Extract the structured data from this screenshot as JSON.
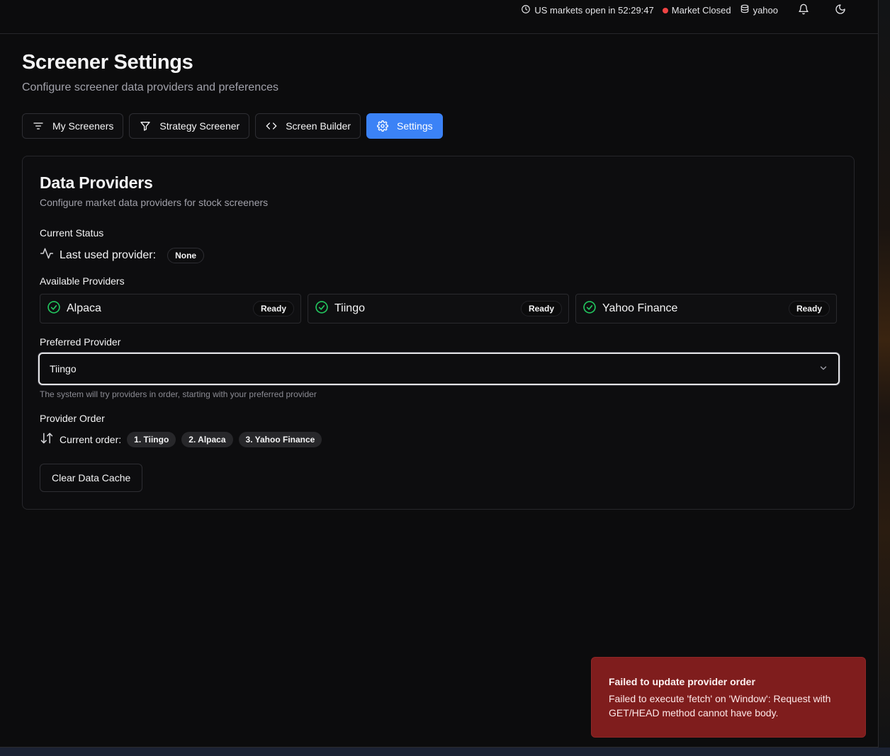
{
  "topbar": {
    "countdown": "US markets open in 52:29:47",
    "market_status": "Market Closed",
    "source": "yahoo",
    "market_status_color": "#ef4444"
  },
  "page": {
    "title": "Screener Settings",
    "subtitle": "Configure screener data providers and preferences"
  },
  "tabs": [
    {
      "label": "My Screeners",
      "icon": "filter-lines-icon",
      "active": false
    },
    {
      "label": "Strategy Screener",
      "icon": "funnel-icon",
      "active": false
    },
    {
      "label": "Screen Builder",
      "icon": "code-icon",
      "active": false
    },
    {
      "label": "Settings",
      "icon": "gear-icon",
      "active": true
    }
  ],
  "accent_color": "#3b82f6",
  "card": {
    "title": "Data Providers",
    "description": "Configure market data providers for stock screeners",
    "current_status_label": "Current Status",
    "last_used_label": "Last used provider:",
    "last_used_value": "None",
    "available_label": "Available Providers",
    "providers": [
      {
        "name": "Alpaca",
        "status": "Ready"
      },
      {
        "name": "Tiingo",
        "status": "Ready"
      },
      {
        "name": "Yahoo Finance",
        "status": "Ready"
      }
    ],
    "ready_icon_color": "#22c55e",
    "preferred_label": "Preferred Provider",
    "preferred_value": "Tiingo",
    "preferred_hint": "The system will try providers in order, starting with your preferred provider",
    "order_label": "Provider Order",
    "current_order_label": "Current order:",
    "order": [
      "1. Tiingo",
      "2. Alpaca",
      "3. Yahoo Finance"
    ],
    "clear_button": "Clear Data Cache"
  },
  "toast": {
    "title": "Failed to update provider order",
    "body": "Failed to execute 'fetch' on 'Window': Request with GET/HEAD method cannot have body.",
    "color": "#7f1d1d"
  }
}
